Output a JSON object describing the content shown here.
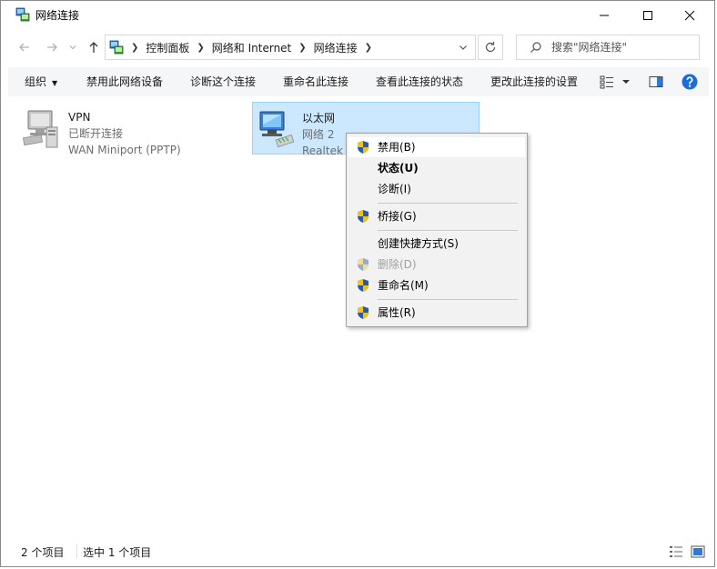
{
  "window": {
    "title": "网络连接"
  },
  "address": {
    "crumbs": [
      "控制面板",
      "网络和 Internet",
      "网络连接"
    ]
  },
  "search": {
    "placeholder": "搜索\"网络连接\""
  },
  "commandbar": {
    "organize": "组织",
    "disable": "禁用此网络设备",
    "diagnose": "诊断这个连接",
    "rename": "重命名此连接",
    "view_status": "查看此连接的状态",
    "change_settings": "更改此连接的设置"
  },
  "items": [
    {
      "name": "VPN",
      "status": "已断开连接",
      "device": "WAN Miniport (PPTP)"
    },
    {
      "name": "以太网",
      "status": "网络 2",
      "device": "Realtek"
    }
  ],
  "context_menu": {
    "disable": "禁用(B)",
    "status": "状态(U)",
    "diagnose": "诊断(I)",
    "bridge": "桥接(G)",
    "shortcut": "创建快捷方式(S)",
    "delete": "删除(D)",
    "rename": "重命名(M)",
    "properties": "属性(R)"
  },
  "statusbar": {
    "count": "2 个项目",
    "selected": "选中 1 个项目"
  },
  "colors": {
    "selection": "#cce8ff",
    "selection_border": "#99d1ff",
    "commandbar_bg": "#f5f6f7",
    "menu_bg": "#f2f2f2",
    "help_blue": "#1c6fd1"
  }
}
